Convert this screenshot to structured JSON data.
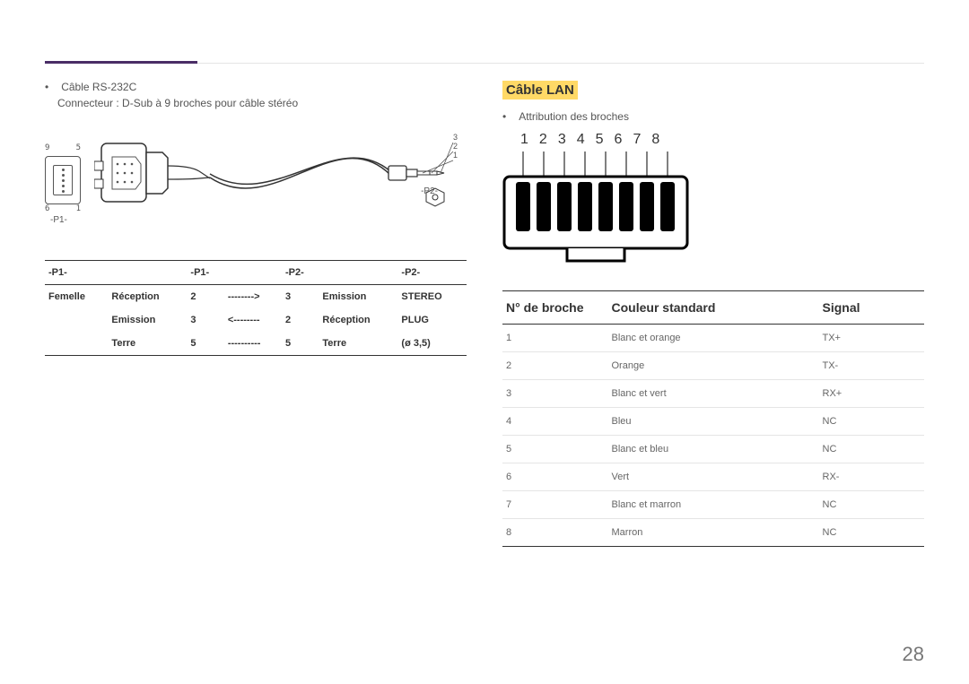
{
  "page_number": "28",
  "rs232": {
    "bullet": "Câble RS-232C",
    "connector_desc": "Connecteur : D-Sub à 9 broches pour câble stéréo",
    "dsub_labels": {
      "top_left": "9",
      "top_right": "5",
      "bottom_left": "6",
      "bottom_right": "1"
    },
    "p1_label": "-P1-",
    "p2_label": "-P2-",
    "jack_labels": [
      "3",
      "2",
      "1"
    ],
    "table": {
      "headers": [
        "-P1-",
        "",
        "-P1-",
        "",
        "-P2-",
        "",
        "-P2-"
      ],
      "rows": [
        [
          "Femelle",
          "Réception",
          "2",
          "-------->",
          "3",
          "Emission",
          "STEREO"
        ],
        [
          "",
          "Emission",
          "3",
          "<--------",
          "2",
          "Réception",
          "PLUG"
        ],
        [
          "",
          "Terre",
          "5",
          "----------",
          "5",
          "Terre",
          "(ø 3,5)"
        ]
      ]
    }
  },
  "lan": {
    "title": "Câble LAN",
    "bullet": "Attribution des broches",
    "pins": [
      "1",
      "2",
      "3",
      "4",
      "5",
      "6",
      "7",
      "8"
    ],
    "table": {
      "headers": [
        "N° de broche",
        "Couleur standard",
        "Signal"
      ],
      "rows": [
        [
          "1",
          "Blanc et orange",
          "TX+"
        ],
        [
          "2",
          "Orange",
          "TX-"
        ],
        [
          "3",
          "Blanc et vert",
          "RX+"
        ],
        [
          "4",
          "Bleu",
          "NC"
        ],
        [
          "5",
          "Blanc et bleu",
          "NC"
        ],
        [
          "6",
          "Vert",
          "RX-"
        ],
        [
          "7",
          "Blanc et marron",
          "NC"
        ],
        [
          "8",
          "Marron",
          "NC"
        ]
      ]
    }
  }
}
